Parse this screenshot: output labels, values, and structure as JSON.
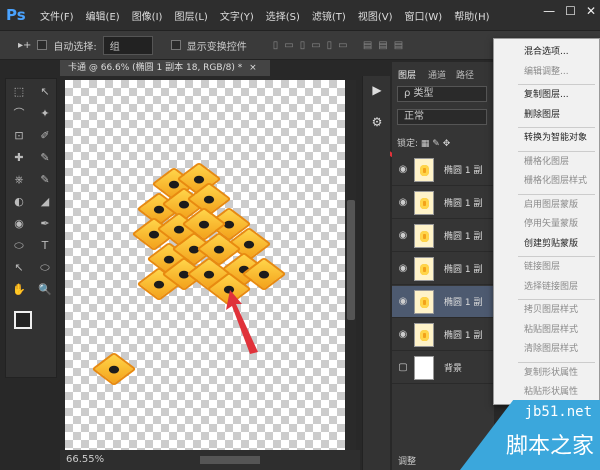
{
  "app": {
    "logo": "Ps",
    "window_buttons": [
      "—",
      "☐",
      "✕"
    ]
  },
  "menubar": [
    "文件(F)",
    "编辑(E)",
    "图像(I)",
    "图层(L)",
    "文字(Y)",
    "选择(S)",
    "滤镜(T)",
    "视图(V)",
    "窗口(W)",
    "帮助(H)"
  ],
  "options": {
    "tool": "▸+",
    "auto_select_label": "自动选择:",
    "auto_select_value": "组",
    "transform_label": "显示变换控件"
  },
  "document": {
    "tab_title": "卡通 @ 66.6% (椭圆 1 副本 18, RGB/8) *",
    "close": "×",
    "zoom": "66.55%"
  },
  "layers_panel": {
    "tabs": [
      "图层",
      "通道",
      "路径"
    ],
    "filter": "ρ 类型",
    "blend_mode": "正常",
    "lock_label": "锁定:",
    "layers": [
      {
        "name": "椭圆 1 副",
        "visible": true,
        "selected": false
      },
      {
        "name": "椭圆 1 副",
        "visible": true,
        "selected": false
      },
      {
        "name": "椭圆 1 副",
        "visible": true,
        "selected": false
      },
      {
        "name": "椭圆 1 副",
        "visible": true,
        "selected": false
      },
      {
        "name": "椭圆 1 副",
        "visible": true,
        "selected": true
      },
      {
        "name": "椭圆 1 副",
        "visible": true,
        "selected": false
      },
      {
        "name": "背景",
        "visible": false,
        "selected": false
      }
    ],
    "bottom_label": "调整"
  },
  "context_menu": [
    {
      "label": "混合选项...",
      "enabled": true
    },
    {
      "label": "编辑调整...",
      "enabled": false
    },
    {
      "sep": true
    },
    {
      "label": "复制图层...",
      "enabled": true
    },
    {
      "label": "删除图层",
      "enabled": true
    },
    {
      "sep": true
    },
    {
      "label": "转换为智能对象",
      "enabled": true
    },
    {
      "sep": true
    },
    {
      "label": "栅格化图层",
      "enabled": false
    },
    {
      "label": "栅格化图层样式",
      "enabled": false
    },
    {
      "sep": true
    },
    {
      "label": "启用图层蒙版",
      "enabled": false
    },
    {
      "label": "停用矢量蒙版",
      "enabled": false
    },
    {
      "label": "创建剪贴蒙版",
      "enabled": true
    },
    {
      "sep": true
    },
    {
      "label": "链接图层",
      "enabled": false
    },
    {
      "label": "选择链接图层",
      "enabled": false
    },
    {
      "sep": true
    },
    {
      "label": "拷贝图层样式",
      "enabled": false
    },
    {
      "label": "粘贴图层样式",
      "enabled": false
    },
    {
      "label": "清除图层样式",
      "enabled": false
    },
    {
      "sep": true
    },
    {
      "label": "复制形状属性",
      "enabled": false
    },
    {
      "label": "粘贴形状属性",
      "enabled": false
    }
  ],
  "watermark": {
    "site": "jb51.net",
    "name": "脚本之家"
  },
  "colors": {
    "accent_arrow": "#e0323a",
    "selected_layer": "#4d5a70",
    "diamond": "#f3a21b",
    "watermark": "#3ba7dc"
  }
}
